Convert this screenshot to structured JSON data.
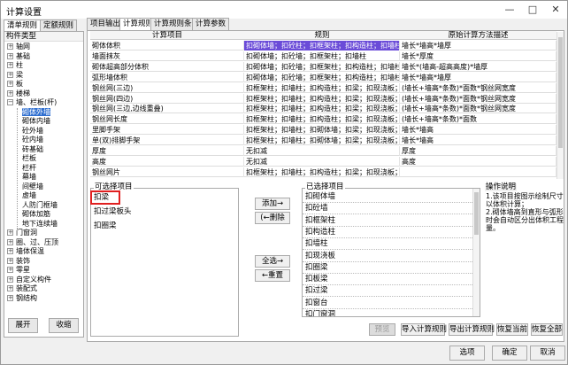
{
  "window": {
    "title": "计算设置",
    "min_glyph": "—",
    "max_glyph": "□",
    "close_glyph": "✕"
  },
  "left_tabs": [
    "清单规则",
    "定额规则"
  ],
  "tree": {
    "header": "构件类型",
    "items": [
      {
        "label": "轴网",
        "level": 1,
        "expander": "+"
      },
      {
        "label": "基础",
        "level": 1,
        "expander": "+"
      },
      {
        "label": "柱",
        "level": 1,
        "expander": "+"
      },
      {
        "label": "梁",
        "level": 1,
        "expander": "+"
      },
      {
        "label": "板",
        "level": 1,
        "expander": "+"
      },
      {
        "label": "楼梯",
        "level": 1,
        "expander": "+"
      },
      {
        "label": "墙、栏板(杆)",
        "level": 1,
        "expander": "−"
      },
      {
        "label": "砌体外墙",
        "level": 2,
        "selected": true
      },
      {
        "label": "砌体内墙",
        "level": 2
      },
      {
        "label": "砼外墙",
        "level": 2
      },
      {
        "label": "砼内墙",
        "level": 2
      },
      {
        "label": "砖基础",
        "level": 2
      },
      {
        "label": "栏板",
        "level": 2
      },
      {
        "label": "栏杆",
        "level": 2
      },
      {
        "label": "幕墙",
        "level": 2
      },
      {
        "label": "间壁墙",
        "level": 2
      },
      {
        "label": "虚墙",
        "level": 2
      },
      {
        "label": "人防门框墙",
        "level": 2
      },
      {
        "label": "砌体加筋",
        "level": 2
      },
      {
        "label": "地下连续墙",
        "level": 2
      },
      {
        "label": "门窗洞",
        "level": 1,
        "expander": "+"
      },
      {
        "label": "圈、过、压顶",
        "level": 1,
        "expander": "+"
      },
      {
        "label": "墙体保温",
        "level": 1,
        "expander": "+"
      },
      {
        "label": "装饰",
        "level": 1,
        "expander": "+"
      },
      {
        "label": "零星",
        "level": 1,
        "expander": "+"
      },
      {
        "label": "自定义构件",
        "level": 1,
        "expander": "+"
      },
      {
        "label": "装配式",
        "level": 1,
        "expander": "+"
      },
      {
        "label": "钢结构",
        "level": 1,
        "expander": "+"
      }
    ],
    "expand_label": "展开",
    "collapse_label": "收缩"
  },
  "right_tabs": [
    "项目输出",
    "计算规则",
    "计算规则条件",
    "计算参数"
  ],
  "rules_table": {
    "headers": [
      "计算项目",
      "规则",
      "原始计算方法描述"
    ],
    "rows": [
      {
        "item": "砌体体积",
        "rule": "扣砌体墙；扣砼柱；扣框架柱；扣构造柱；扣墙柱；扣...",
        "desc": "墙长*墙高*墙厚",
        "selected": true
      },
      {
        "item": "墙面抹灰",
        "rule": "扣砌体墙；扣砼墙；扣框架柱；扣墙柱",
        "desc": "墙长*厚度"
      },
      {
        "item": "砌体超高部分体积",
        "rule": "扣砌体墙；扣砼墙；扣框架柱；扣构造柱；扣墙柱；扣...",
        "desc": "墙长*(墙高-超高高度)*墙厚"
      },
      {
        "item": "弧形墙体积",
        "rule": "扣砌体墙；扣砼墙；扣框架柱；扣构造柱；扣墙柱；扣...",
        "desc": "墙长*墙高*墙厚"
      },
      {
        "item": "钢丝网(三边)",
        "rule": "扣框架柱；扣墙柱；扣构造柱；扣梁；扣现浇板；扣门...",
        "desc": "(墙长+墙高*条数)*面数*钢丝网宽度"
      },
      {
        "item": "钢丝网(四边)",
        "rule": "扣框架柱；扣墙柱；扣构造柱；扣梁；扣现浇板；扣门...",
        "desc": "(墙长+墙高*条数)*面数*钢丝网宽度"
      },
      {
        "item": "钢丝网(三边,边线重叠)",
        "rule": "扣框架柱；扣墙柱；扣构造柱；扣梁；扣现浇板；扣门...",
        "desc": "(墙长+墙高*条数)*面数*钢丝网宽度"
      },
      {
        "item": "钢丝网长度",
        "rule": "扣框架柱；扣墙柱；扣构造柱；扣梁；扣现浇板；扣门...",
        "desc": "(墙长+墙高*条数)*面数"
      },
      {
        "item": "里脚手架",
        "rule": "扣框架柱；扣墙柱；扣砌体墙；扣梁；扣现浇板；扣...",
        "desc": "墙长*墙高"
      },
      {
        "item": "单(双)排脚手架",
        "rule": "扣框架柱；扣墙柱；扣砌体墙；扣梁；扣现浇板；扣...",
        "desc": "墙长*墙高"
      },
      {
        "item": "厚度",
        "rule": "无扣减",
        "desc": "厚度"
      },
      {
        "item": "高度",
        "rule": "无扣减",
        "desc": "高度"
      },
      {
        "item": "钢丝网片",
        "rule": "扣框架柱；扣墙柱；扣构造柱；扣梁；扣现浇板；扣门...",
        "desc": ""
      }
    ]
  },
  "available_group": {
    "title": "可选择项目",
    "items": [
      "扣梁",
      "扣过梁板头",
      "扣圈梁"
    ]
  },
  "buttons_mid": {
    "add": "添加→",
    "remove": "(←删除",
    "add_all": "全选→",
    "remove_all": "←重置"
  },
  "selected_group": {
    "title": "已选择项目",
    "items": [
      "扣砌体墙",
      "扣砼墙",
      "扣框架柱",
      "扣构造柱",
      "扣墙柱",
      "扣现浇板",
      "扣圈梁",
      "扣板梁",
      "扣过梁",
      "扣窗台",
      "扣门窗洞"
    ]
  },
  "description": {
    "title": "操作说明",
    "text": "1.该项目按图示绘制尺寸\n以体积计算；\n2.砌体墙高到直形与弧形\n时会自动区分出体积工程\n量。"
  },
  "bottom_buttons": {
    "preview": "预览",
    "import": "导入计算规则",
    "export": "导出计算规则",
    "restore_current": "恢复当前",
    "restore_all": "恢复全部"
  },
  "footer_buttons": {
    "options": "选项",
    "ok": "确定",
    "cancel": "取消"
  }
}
